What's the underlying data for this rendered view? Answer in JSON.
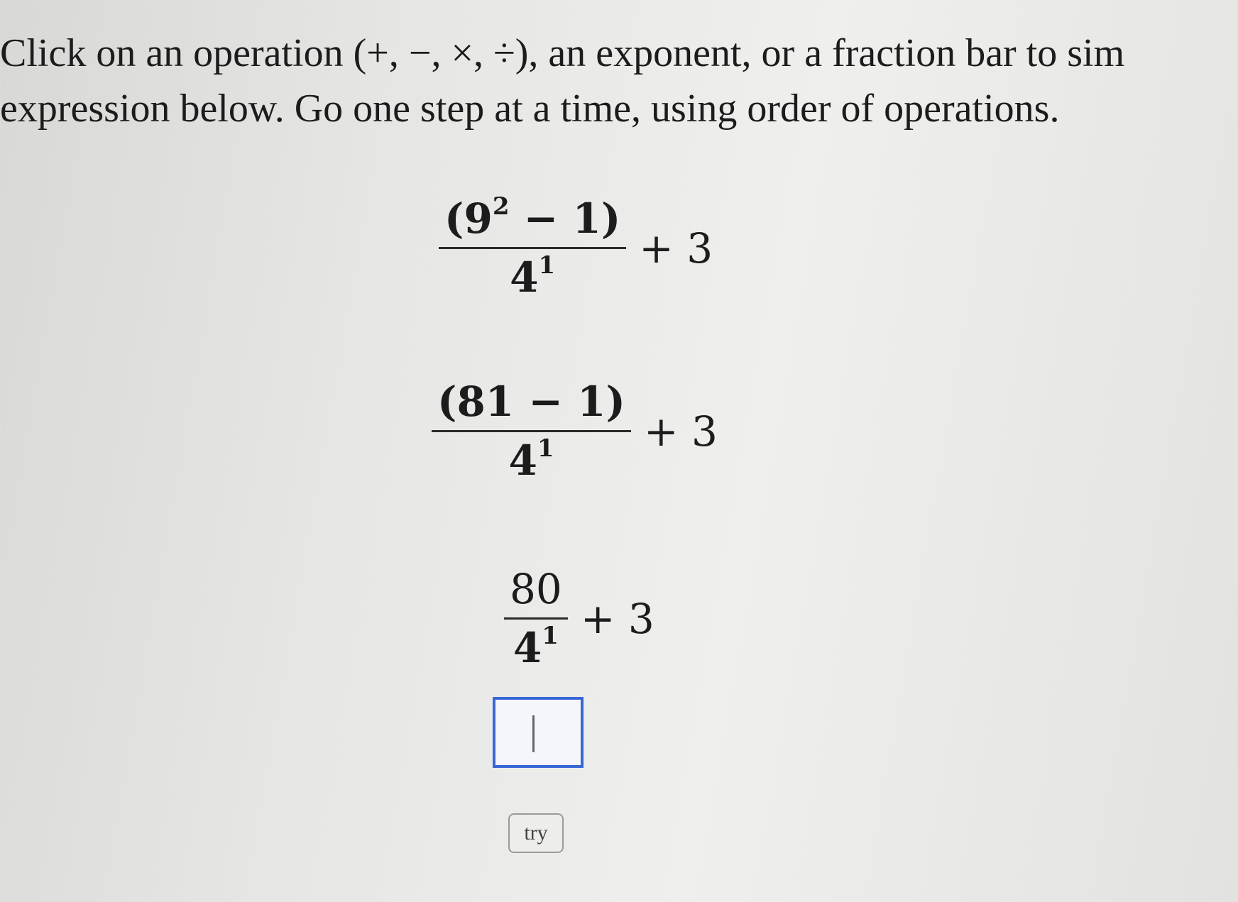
{
  "instructions": {
    "line1": "Click on an operation (+, −, ×, ÷), an exponent, or a fraction bar to sim",
    "line2": "expression below. Go one step at a time, using order of operations."
  },
  "steps": [
    {
      "numerator_open": "(9",
      "numerator_exp": "2",
      "numerator_rest": " − 1)",
      "denominator_base": "4",
      "denominator_exp": "1",
      "operator": "+ 3"
    },
    {
      "numerator": "(81 − 1)",
      "denominator_base": "4",
      "denominator_exp": "1",
      "operator": "+ 3"
    },
    {
      "numerator": "80",
      "denominator_base": "4",
      "denominator_exp": "1",
      "operator": "+ 3"
    }
  ],
  "answer": {
    "value": ""
  },
  "try_button": {
    "label": "try"
  }
}
